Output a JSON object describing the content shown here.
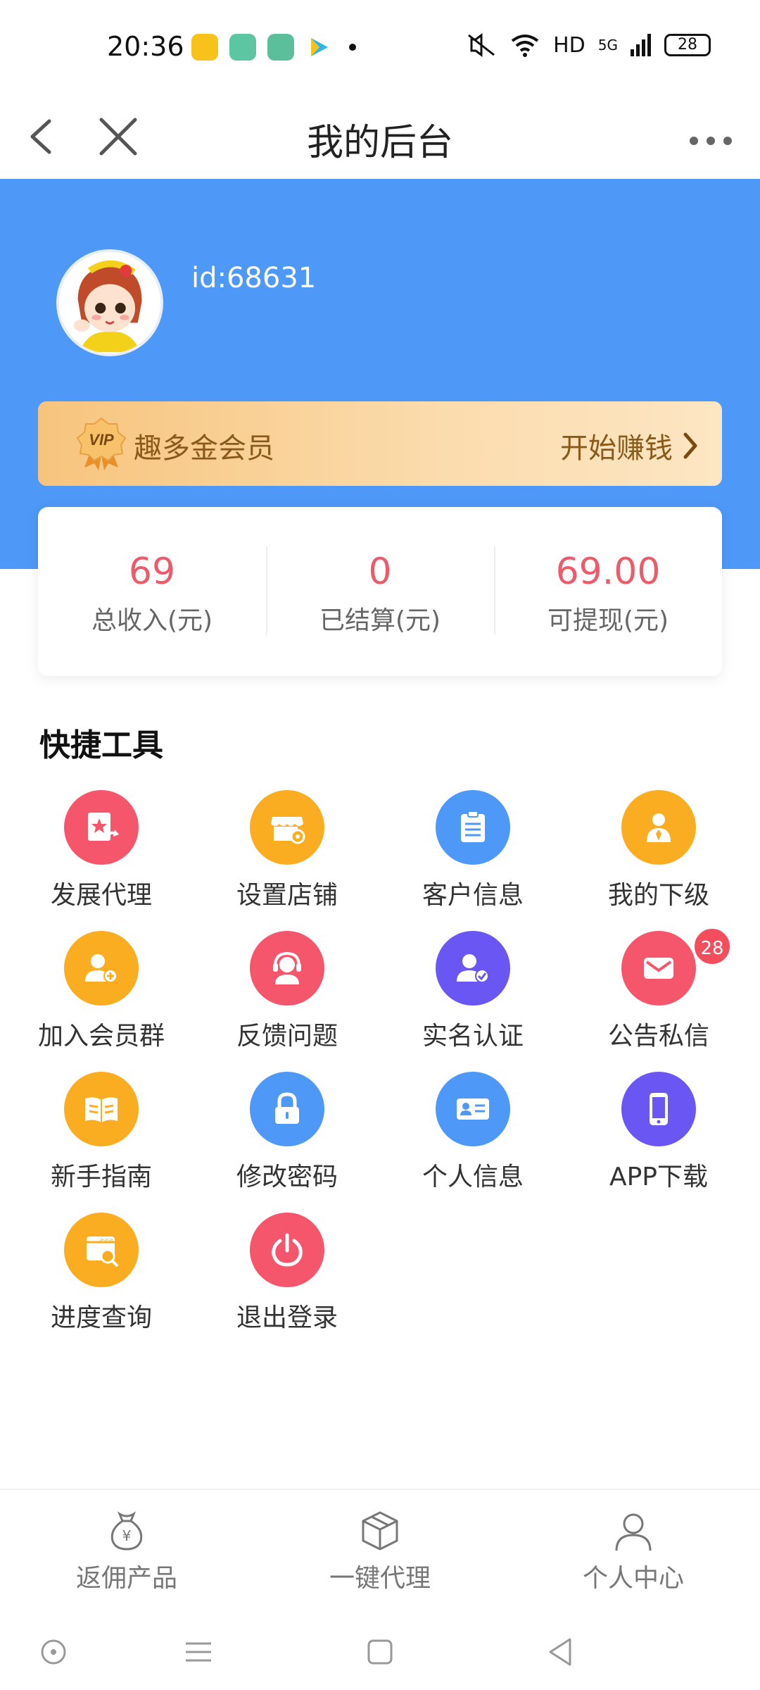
{
  "status_bar": {
    "time": "20:36",
    "network": "HD",
    "signal": "5G",
    "battery": "28"
  },
  "nav": {
    "title": "我的后台"
  },
  "profile": {
    "id_text": "id:68631"
  },
  "vip": {
    "badge_text": "VIP",
    "label": "趣多金会员",
    "cta": "开始赚钱"
  },
  "stats": [
    {
      "value": "69",
      "label": "总收入(元)"
    },
    {
      "value": "0",
      "label": "已结算(元)"
    },
    {
      "value": "69.00",
      "label": "可提现(元)"
    }
  ],
  "tools_section": {
    "title": "快捷工具",
    "items": [
      {
        "label": "发展代理",
        "icon": "star-share-icon",
        "color": "#f5566b"
      },
      {
        "label": "设置店铺",
        "icon": "store-settings-icon",
        "color": "#fbad22"
      },
      {
        "label": "客户信息",
        "icon": "clipboard-icon",
        "color": "#4e98f7"
      },
      {
        "label": "我的下级",
        "icon": "subordinate-icon",
        "color": "#fbad22"
      },
      {
        "label": "加入会员群",
        "icon": "add-user-icon",
        "color": "#fbad22"
      },
      {
        "label": "反馈问题",
        "icon": "headset-icon",
        "color": "#f5566b"
      },
      {
        "label": "实名认证",
        "icon": "verified-user-icon",
        "color": "#6a56f2"
      },
      {
        "label": "公告私信",
        "icon": "mail-icon",
        "color": "#f5566b",
        "badge": "28"
      },
      {
        "label": "新手指南",
        "icon": "book-icon",
        "color": "#fbad22"
      },
      {
        "label": "修改密码",
        "icon": "lock-icon",
        "color": "#4e98f7"
      },
      {
        "label": "个人信息",
        "icon": "id-card-icon",
        "color": "#4e98f7"
      },
      {
        "label": "APP下载",
        "icon": "phone-icon",
        "color": "#6a56f2"
      },
      {
        "label": "进度查询",
        "icon": "progress-search-icon",
        "color": "#fbad22"
      },
      {
        "label": "退出登录",
        "icon": "power-icon",
        "color": "#f5566b"
      }
    ]
  },
  "tabs": [
    {
      "label": "返佣产品",
      "icon": "money-bag-icon"
    },
    {
      "label": "一键代理",
      "icon": "cube-icon"
    },
    {
      "label": "个人中心",
      "icon": "user-icon"
    }
  ],
  "colors": {
    "primary": "#4e98f7",
    "stat_value": "#ef5a6a",
    "vip_text": "#8a5a1b"
  }
}
